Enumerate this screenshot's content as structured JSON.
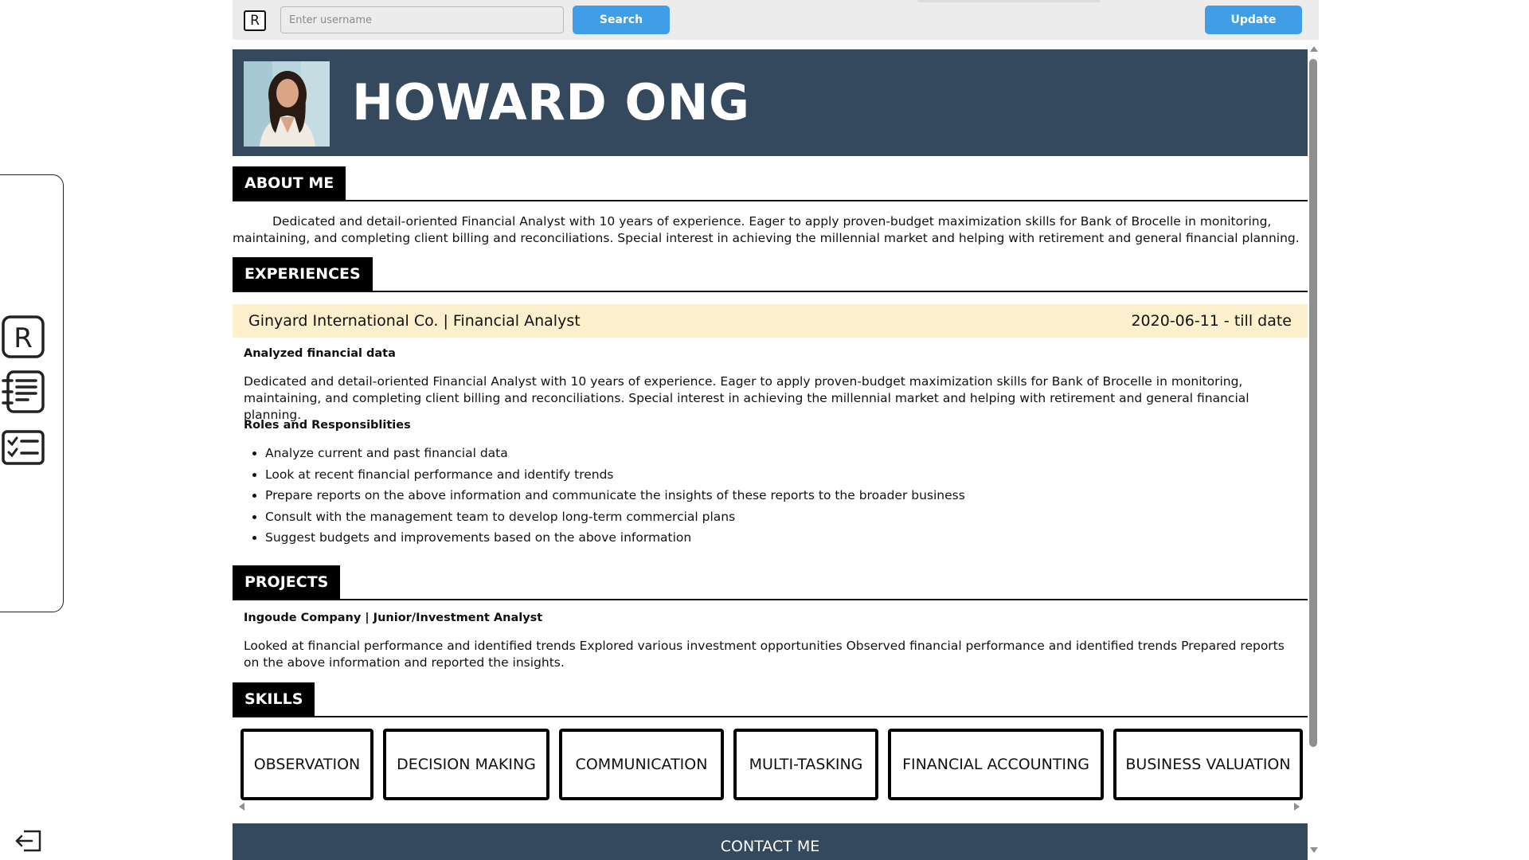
{
  "toolbar": {
    "logo_letter": "R",
    "search_placeholder": "Enter username",
    "search_label": "Search",
    "update_label": "Update"
  },
  "sidebar": {
    "items": [
      {
        "icon": "resume-logo-icon",
        "label": "R"
      },
      {
        "icon": "notebook-list-icon"
      },
      {
        "icon": "checklist-icon"
      }
    ],
    "exit_icon": "logout-icon"
  },
  "resume": {
    "name": "HOWARD ONG",
    "sections": {
      "about": "ABOUT ME",
      "experiences": "EXPERIENCES",
      "projects": "PROJECTS",
      "skills": "SKILLS",
      "contact": "CONTACT ME"
    },
    "about_text": "Dedicated and detail-oriented Financial Analyst with 10 years of experience. Eager to apply proven-budget maximization skills for Bank of Brocelle in monitoring, maintaining, and completing client billing and reconciliations. Special interest in achieving the millennial market and helping with retirement and general financial planning.",
    "experience": {
      "title": "Ginyard International Co. | Financial Analyst",
      "date": "2020-06-11 - till date",
      "subtitle": "Analyzed financial data",
      "description": "Dedicated and detail-oriented Financial Analyst with 10 years of experience. Eager to apply proven-budget maximization skills for Bank of Brocelle in monitoring, maintaining, and completing client billing and reconciliations. Special interest in achieving the millennial market and helping with retirement and general financial planning.",
      "roles_heading": "Roles and Responsiblities",
      "roles": [
        "Analyze current and past financial data",
        "Look at recent financial performance and identify trends",
        "Prepare reports on the above information and communicate the insights of these reports to the broader business",
        "Consult with the management team to develop long-term commercial plans",
        "Suggest budgets and improvements based on the above information"
      ]
    },
    "project": {
      "title": "Ingoude Company | Junior/Investment Analyst",
      "description": "Looked at financial performance and identified trends Explored various investment opportunities Observed financial performance and identified trends Prepared reports on the above information and reported the insights."
    },
    "skills": [
      "OBSERVATION",
      "DECISION MAKING",
      "COMMUNICATION",
      "MULTI-TASKING",
      "FINANCIAL ACCOUNTING",
      "BUSINESS VALUATION"
    ]
  }
}
